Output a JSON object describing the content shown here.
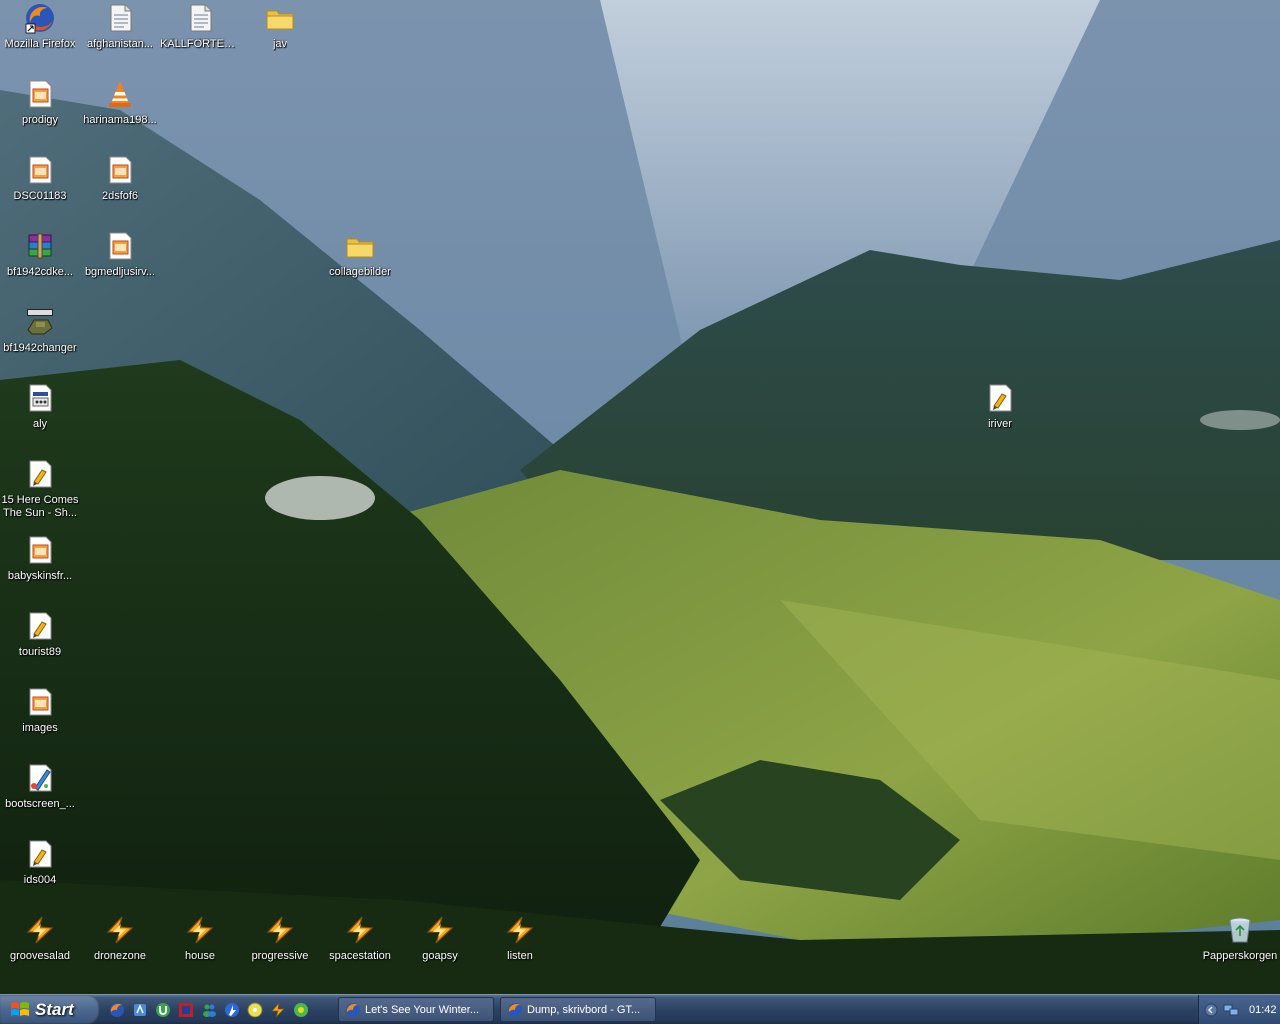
{
  "desktop": {
    "icons": [
      {
        "label": "Mozilla Firefox",
        "icon": "firefox-shortcut-icon"
      },
      {
        "label": "afghanistan...",
        "icon": "document-icon"
      },
      {
        "label": "KÄLLFÖRTEC...",
        "icon": "document-icon"
      },
      {
        "label": "jav",
        "icon": "folder-icon"
      },
      {
        "label": "prodigy",
        "icon": "image-file-icon"
      },
      {
        "label": "harinama198...",
        "icon": "vlc-cone-icon"
      },
      {
        "label": "DSC01183",
        "icon": "image-file-icon"
      },
      {
        "label": "2dsfof6",
        "icon": "image-file-icon"
      },
      {
        "label": "bf1942cdke...",
        "icon": "winrar-archive-icon"
      },
      {
        "label": "bgmedljusirv...",
        "icon": "image-file-icon"
      },
      {
        "label": "collagebilder",
        "icon": "folder-icon"
      },
      {
        "label": "bf1942changer",
        "icon": "battlefield-app-icon"
      },
      {
        "label": "aly",
        "icon": "settings-file-icon"
      },
      {
        "label": "iriver",
        "icon": "audio-file-icon"
      },
      {
        "label": "15 Here Comes The Sun - Sh...",
        "icon": "audio-file-icon"
      },
      {
        "label": "babyskinsfr...",
        "icon": "image-file-icon"
      },
      {
        "label": "tourist89",
        "icon": "audio-file-icon"
      },
      {
        "label": "images",
        "icon": "image-file-icon"
      },
      {
        "label": "bootscreen_...",
        "icon": "paint-file-icon"
      },
      {
        "label": "ids004",
        "icon": "audio-file-icon"
      },
      {
        "label": "groovesalad",
        "icon": "winamp-playlist-icon"
      },
      {
        "label": "dronezone",
        "icon": "winamp-playlist-icon"
      },
      {
        "label": "house",
        "icon": "winamp-playlist-icon"
      },
      {
        "label": "progressive",
        "icon": "winamp-playlist-icon"
      },
      {
        "label": "spacestation",
        "icon": "winamp-playlist-icon"
      },
      {
        "label": "goapsy",
        "icon": "winamp-playlist-icon"
      },
      {
        "label": "listen",
        "icon": "winamp-playlist-icon"
      },
      {
        "label": "Papperskorgen",
        "icon": "recycle-bin-icon"
      }
    ]
  },
  "taskbar": {
    "start_label": "Start",
    "quick_launch": [
      "firefox-icon",
      "explorer-icon",
      "utorrent-icon",
      "media-icon",
      "messenger-icon",
      "azureus-icon",
      "disc-icon",
      "winamp-icon",
      "program-icon"
    ],
    "tasks": [
      {
        "label": "Let's See Your Winter...",
        "icon": "firefox-icon"
      },
      {
        "label": "Dump, skrivbord - GT...",
        "icon": "firefox-icon"
      }
    ],
    "tray_icons": [
      "tray-arrow-icon",
      "network-icon"
    ],
    "clock": "01:42"
  },
  "colors": {
    "taskbar": "#2c4263",
    "start": "#4f6a91",
    "label_text": "#ffffff"
  }
}
